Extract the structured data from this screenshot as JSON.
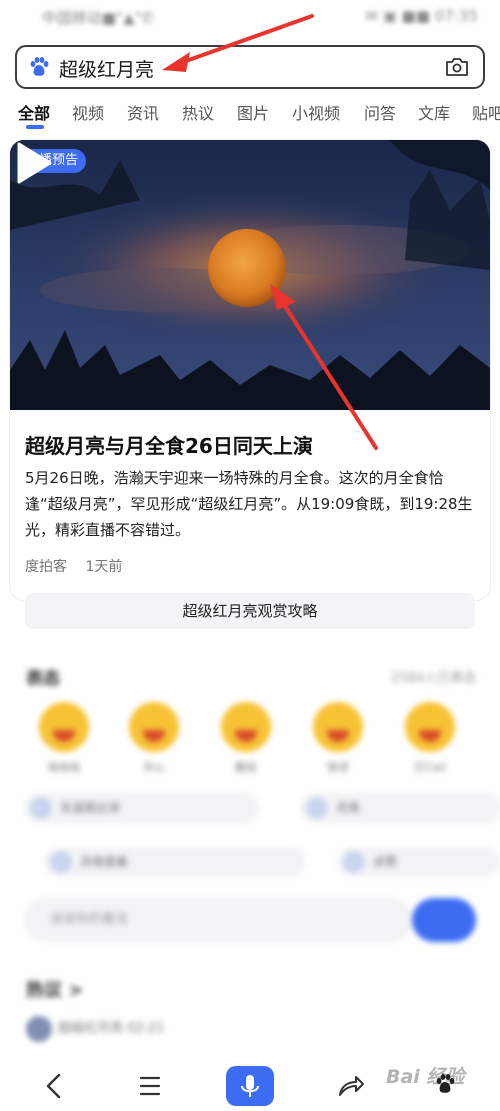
{
  "status_bar": {
    "left": "中国移动■\"▲\"✆",
    "right": "✉ ▣ ■■ 07:35"
  },
  "search": {
    "query": "超级红月亮"
  },
  "tabs": [
    {
      "label": "全部",
      "active": true
    },
    {
      "label": "视频"
    },
    {
      "label": "资讯"
    },
    {
      "label": "热议"
    },
    {
      "label": "图片"
    },
    {
      "label": "小视频"
    },
    {
      "label": "问答"
    },
    {
      "label": "文库"
    },
    {
      "label": "贴吧"
    }
  ],
  "card": {
    "badge": "直播预告",
    "headline": "超级月亮与月全食26日同天上演",
    "summary": "5月26日晚，浩瀚天宇迎来一场特殊的月全食。这次的月全食恰逢“超级月亮”，罕见形成“超级红月亮”。从19:09食既，到19:28生光，精彩直播不容错过。",
    "source": "度拍客",
    "time_ago": "1天前"
  },
  "guide_button": "超级红月亮观赏攻略",
  "reactions": {
    "title": "表态",
    "count": "2584人已表态",
    "items": [
      "哈哈哈",
      "开心",
      "酷炫",
      "惊讶",
      "打Call"
    ]
  },
  "discussion_pills": [
    "天涯若比邻",
    "月亮",
    "月亮很美",
    "点赞"
  ],
  "comment": {
    "placeholder": "说说你的看法"
  },
  "hot": {
    "title": "热议 >",
    "first": "超级红月亮 02:21"
  },
  "watermark": {
    "text": "Bai 经验"
  },
  "colors": {
    "accent": "#3d6cf3",
    "arrow": "#e8342c"
  }
}
